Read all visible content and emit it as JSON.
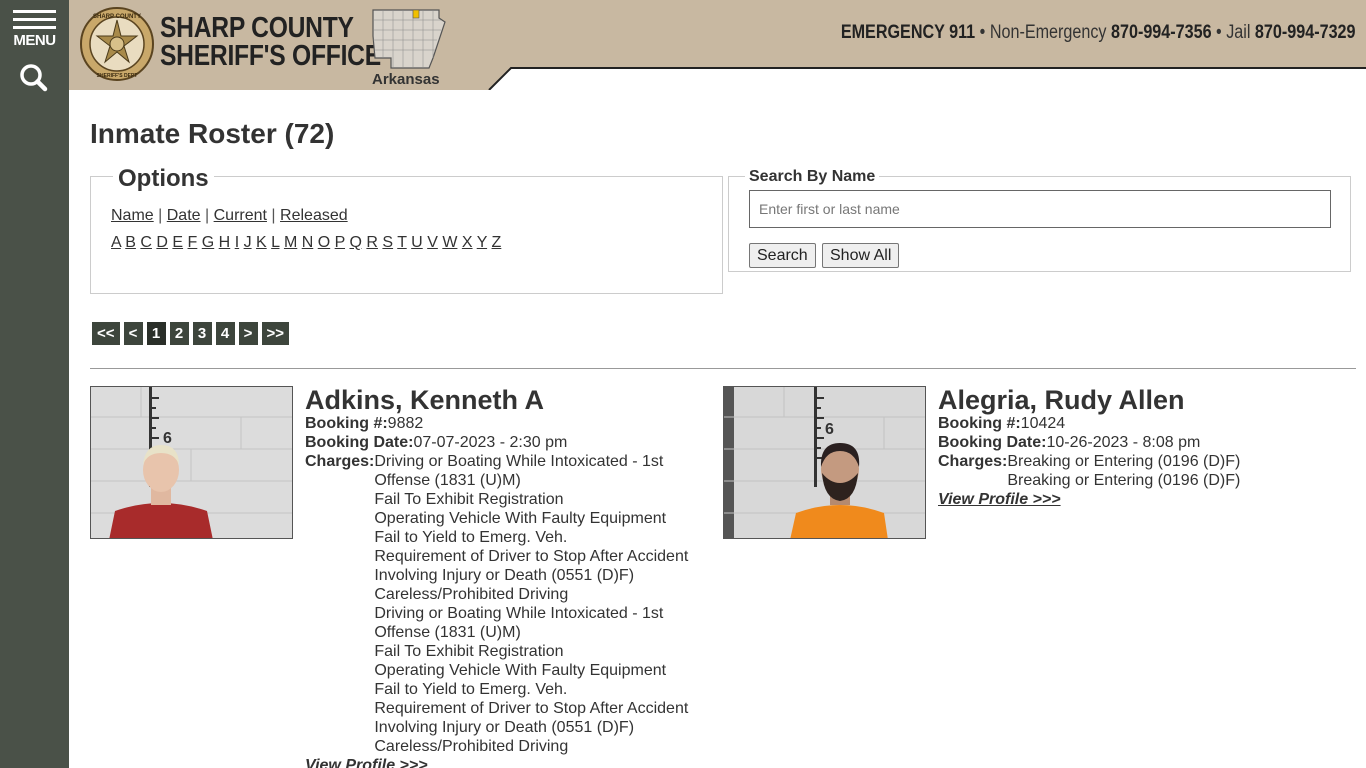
{
  "sidebar": {
    "menu_label": "MENU"
  },
  "header": {
    "title_line1": "SHARP COUNTY",
    "title_line2": "SHERIFF'S OFFICE",
    "state_name": "Arkansas",
    "contact": {
      "emergency_label": "EMERGENCY 911",
      "sep": " • ",
      "non_emergency_label": "Non-Emergency",
      "non_emergency_number": "870-994-7356",
      "jail_label": "Jail",
      "jail_number": "870-994-7329"
    },
    "seal_text": "SHARP COUNTY SHERIFF'S DEPARTMENT"
  },
  "page_title": "Inmate Roster (72)",
  "options": {
    "legend": "Options",
    "sort_links": [
      "Name",
      "Date",
      "Current",
      "Released"
    ],
    "letters": [
      "A",
      "B",
      "C",
      "D",
      "E",
      "F",
      "G",
      "H",
      "I",
      "J",
      "K",
      "L",
      "M",
      "N",
      "O",
      "P",
      "Q",
      "R",
      "S",
      "T",
      "U",
      "V",
      "W",
      "X",
      "Y",
      "Z"
    ]
  },
  "search": {
    "legend": "Search By Name",
    "placeholder": "Enter first or last name",
    "search_label": "Search",
    "show_all_label": "Show All"
  },
  "pager": {
    "first": "<<",
    "prev": "<",
    "pages": [
      "1",
      "2",
      "3",
      "4"
    ],
    "current": "1",
    "next": ">",
    "last": ">>"
  },
  "inmates": [
    {
      "name": "Adkins, Kenneth A",
      "booking_label": "Booking #:",
      "booking_number": "9882",
      "date_label": "Booking Date:",
      "booking_date": "07-07-2023 - 2:30 pm",
      "charges_label": "Charges:",
      "charges": [
        "Driving or Boating While Intoxicated - 1st Offense (1831 (U)M)",
        "Fail To Exhibit Registration",
        "Operating Vehicle With Faulty Equipment",
        "Fail to Yield to Emerg. Veh.",
        "Requirement of Driver to Stop After Accident Involving Injury or Death (0551 (D)F)",
        "Careless/Prohibited Driving",
        "Driving or Boating While Intoxicated - 1st Offense (1831 (U)M)",
        "Fail To Exhibit Registration",
        "Operating Vehicle With Faulty Equipment",
        "Fail to Yield to Emerg. Veh.",
        "Requirement of Driver to Stop After Accident Involving Injury or Death (0551 (D)F)",
        "Careless/Prohibited Driving"
      ],
      "profile_link": "View Profile >>>",
      "shirt_color": "#a82b2b"
    },
    {
      "name": "Alegria, Rudy Allen",
      "booking_label": "Booking #:",
      "booking_number": "10424",
      "date_label": "Booking Date:",
      "booking_date": "10-26-2023 - 8:08 pm",
      "charges_label": "Charges:",
      "charges": [
        "Breaking or Entering (0196 (D)F)",
        "Breaking or Entering (0196 (D)F)"
      ],
      "profile_link": "View Profile >>>",
      "shirt_color": "#f08a1c"
    }
  ],
  "colors": {
    "sidebar": "#4a5148",
    "header": "#c8b8a1",
    "pager": "#3d453c"
  }
}
